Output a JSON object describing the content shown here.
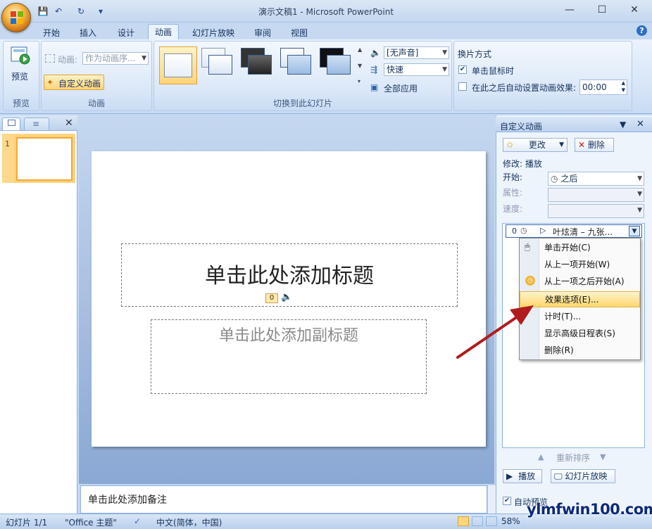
{
  "window": {
    "title": "演示文稿1 - Microsoft PowerPoint",
    "minimize": "—",
    "maximize": "☐",
    "close": "✕",
    "help": "?"
  },
  "qat": {
    "save": "💾",
    "undo": "↶",
    "redo": "↻",
    "more": "▾"
  },
  "tabs": [
    {
      "label": "开始"
    },
    {
      "label": "插入"
    },
    {
      "label": "设计"
    },
    {
      "label": "动画",
      "active": true
    },
    {
      "label": "幻灯片放映"
    },
    {
      "label": "审阅"
    },
    {
      "label": "视图"
    }
  ],
  "ribbon": {
    "preview": {
      "button": "预览",
      "group": "预览"
    },
    "animation": {
      "anim_label": "动画:",
      "anim_value": "作为动画序...",
      "custom_button": "自定义动画",
      "group": "动画"
    },
    "transition": {
      "sound_value": "[无声音]",
      "speed_value": "快速",
      "apply_all": "全部应用",
      "group": "切换到此幻灯片"
    },
    "advance": {
      "title": "换片方式",
      "on_click": "单击鼠标时",
      "on_click_checked": true,
      "auto_label": "在此之后自动设置动画效果:",
      "auto_checked": false,
      "auto_time": "00:00"
    }
  },
  "slide": {
    "title_placeholder": "单击此处添加标题",
    "subtitle_placeholder": "单击此处添加副标题",
    "anim_tag": "0",
    "sound_icon": "🔈"
  },
  "slides_pane": {
    "number": "1",
    "close": "✕"
  },
  "notes": {
    "placeholder": "单击此处添加备注"
  },
  "taskpane": {
    "title": "自定义动画",
    "change_button": "更改",
    "delete_button": "删除",
    "modify_label": "修改: 播放",
    "start_label": "开始:",
    "start_value": "之后",
    "property_label": "属性:",
    "speed_label": "速度:",
    "item": {
      "index": "0",
      "text": "叶炫清 – 九张..."
    },
    "reorder_label": "重新排序",
    "play_button": "播放",
    "slideshow_button": "幻灯片放映",
    "autopreview_label": "自动预览"
  },
  "context_menu": {
    "items": [
      {
        "label": "单击开始(C)"
      },
      {
        "label": "从上一项开始(W)"
      },
      {
        "label": "从上一项之后开始(A)"
      },
      {
        "label": "效果选项(E)...",
        "highlighted": true
      },
      {
        "label": "计时(T)..."
      },
      {
        "label": "显示高级日程表(S)"
      },
      {
        "label": "删除(R)"
      }
    ]
  },
  "statusbar": {
    "slide": "幻灯片 1/1",
    "theme": "\"Office 主题\"",
    "language": "中文(简体，中国)",
    "zoom": "58%"
  },
  "watermark": "ylmfwin100.com",
  "colors": {
    "accent": "#f5a733",
    "arrow": "#b01c1c",
    "ribbon": "#d5e4f7"
  }
}
